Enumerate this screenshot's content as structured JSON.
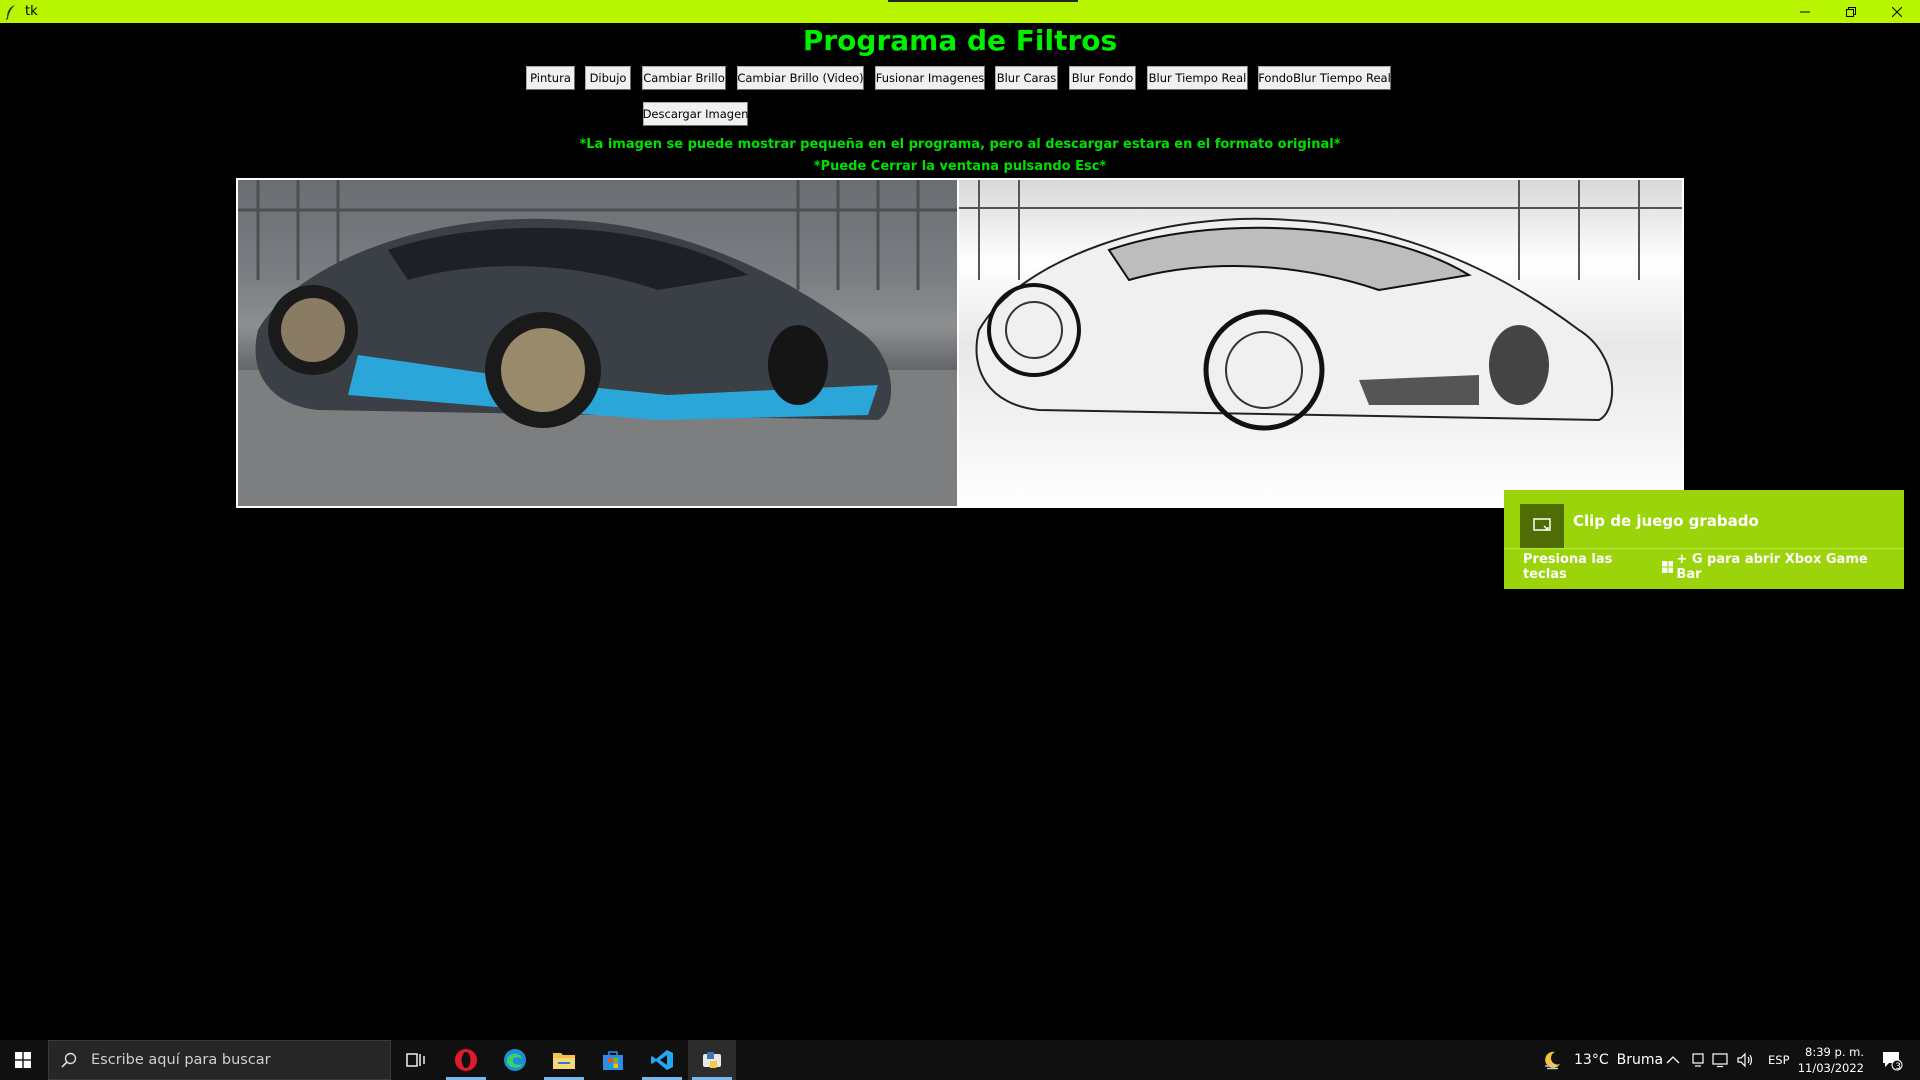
{
  "window": {
    "title": "tk",
    "app_icon": "feather-icon",
    "controls": [
      "minimize-icon",
      "restore-icon",
      "close-icon"
    ]
  },
  "app": {
    "heading": "Programa de Filtros",
    "buttons": [
      "Pintura",
      "Dibujo",
      "Cambiar Brillo",
      "Cambiar Brillo (Video)",
      "Fusionar Imagenes",
      "Blur Caras",
      "Blur Fondo",
      "Blur Tiempo Real",
      "FondoBlur Tiempo Real"
    ],
    "download_button": "Descargar Imagen",
    "note_1": "*La imagen se puede mostrar pequeña en el programa, pero al descargar estara en el formato original*",
    "note_2": "*Puede Cerrar la ventana pulsando Esc*",
    "images": {
      "original": "car-photo-color",
      "filtered": "car-photo-pencil-sketch"
    }
  },
  "toast": {
    "title": "Clip de juego grabado",
    "body_before": "Presiona las teclas",
    "body_after": "+ G para abrir Xbox Game Bar",
    "icon": "capture-icon",
    "accent": "#9bd40a"
  },
  "taskbar": {
    "search_placeholder": "Escribe aquí para buscar",
    "apps": [
      "task-view-icon",
      "opera-icon",
      "edge-icon",
      "file-explorer-icon",
      "store-icon",
      "vscode-icon",
      "python-icon"
    ],
    "weather_temp": "13°C",
    "weather_text": "Bruma",
    "language": "ESP",
    "time": "8:39 p. m.",
    "date": "11/03/2022",
    "notification_count": "3"
  }
}
